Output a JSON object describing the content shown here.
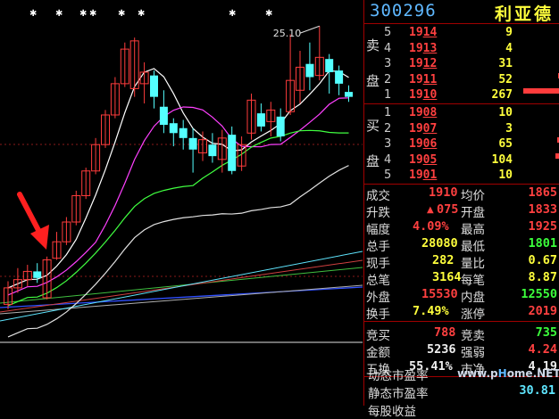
{
  "stock": {
    "code": "300296",
    "name": "利亚德"
  },
  "chart": {
    "peak_label": "25.10",
    "candles": [
      {
        "o": 8.2,
        "c": 9.2,
        "h": 9.6,
        "l": 7.9
      },
      {
        "o": 9.2,
        "c": 9.7,
        "h": 10.4,
        "l": 8.9
      },
      {
        "o": 9.7,
        "c": 10.2,
        "h": 10.6,
        "l": 9.3
      },
      {
        "o": 10.2,
        "c": 9.8,
        "h": 10.7,
        "l": 9.5
      },
      {
        "o": 8.6,
        "c": 10.9,
        "h": 11.1,
        "l": 8.5
      },
      {
        "o": 11.0,
        "c": 12.0,
        "h": 12.6,
        "l": 10.9
      },
      {
        "o": 12.0,
        "c": 13.2,
        "h": 13.5,
        "l": 11.8
      },
      {
        "o": 13.2,
        "c": 14.8,
        "h": 15.1,
        "l": 13.0
      },
      {
        "o": 14.8,
        "c": 16.3,
        "h": 16.5,
        "l": 14.6
      },
      {
        "o": 16.3,
        "c": 17.9,
        "h": 18.3,
        "l": 16.1
      },
      {
        "o": 17.9,
        "c": 19.7,
        "h": 20.0,
        "l": 17.7
      },
      {
        "o": 19.7,
        "c": 21.6,
        "h": 22.0,
        "l": 19.5
      },
      {
        "o": 21.6,
        "c": 23.7,
        "h": 24.1,
        "l": 21.4
      },
      {
        "o": 21.3,
        "c": 24.2,
        "h": 24.4,
        "l": 20.8
      },
      {
        "o": 21.6,
        "c": 22.3,
        "h": 22.9,
        "l": 20.4
      },
      {
        "o": 22.1,
        "c": 20.8,
        "h": 22.4,
        "l": 20.1
      },
      {
        "o": 20.2,
        "c": 19.1,
        "h": 21.2,
        "l": 18.6
      },
      {
        "o": 19.2,
        "c": 18.6,
        "h": 19.5,
        "l": 17.8
      },
      {
        "o": 18.9,
        "c": 18.3,
        "h": 19.4,
        "l": 17.6
      },
      {
        "o": 18.3,
        "c": 17.6,
        "h": 18.9,
        "l": 16.2
      },
      {
        "o": 17.4,
        "c": 18.2,
        "h": 18.7,
        "l": 16.9
      },
      {
        "o": 17.9,
        "c": 17.2,
        "h": 18.6,
        "l": 16.8
      },
      {
        "o": 17.0,
        "c": 18.3,
        "h": 18.8,
        "l": 16.2
      },
      {
        "o": 18.5,
        "c": 16.3,
        "h": 19.0,
        "l": 16.1
      },
      {
        "o": 16.6,
        "c": 17.9,
        "h": 18.4,
        "l": 16.3
      },
      {
        "o": 18.6,
        "c": 20.6,
        "h": 21.0,
        "l": 18.2
      },
      {
        "o": 19.8,
        "c": 19.0,
        "h": 20.4,
        "l": 18.7
      },
      {
        "o": 19.3,
        "c": 20.0,
        "h": 20.5,
        "l": 18.4
      },
      {
        "o": 19.6,
        "c": 18.4,
        "h": 20.1,
        "l": 18.1
      },
      {
        "o": 19.9,
        "c": 21.8,
        "h": 24.6,
        "l": 19.7
      },
      {
        "o": 21.2,
        "c": 22.6,
        "h": 23.6,
        "l": 20.4
      },
      {
        "o": 22.8,
        "c": 22.0,
        "h": 24.1,
        "l": 21.2
      },
      {
        "o": 22.1,
        "c": 23.2,
        "h": 25.1,
        "l": 21.8
      },
      {
        "o": 23.1,
        "c": 22.3,
        "h": 23.4,
        "l": 21.0
      },
      {
        "o": 22.4,
        "c": 21.6,
        "h": 22.7,
        "l": 20.9
      },
      {
        "o": 21.1,
        "c": 20.8,
        "h": 21.5,
        "l": 20.5
      }
    ]
  },
  "orderbook": {
    "sell_label": [
      "卖",
      "盘"
    ],
    "buy_label": [
      "买",
      "盘"
    ],
    "asks": [
      {
        "level": "5",
        "price": "1914",
        "vol": "9",
        "bar": 0
      },
      {
        "level": "4",
        "price": "1913",
        "vol": "4",
        "bar": 0
      },
      {
        "level": "3",
        "price": "1912",
        "vol": "31",
        "bar": 0
      },
      {
        "level": "2",
        "price": "1911",
        "vol": "52",
        "bar": 0.02
      },
      {
        "level": "1",
        "price": "1910",
        "vol": "267",
        "bar": 0.9
      }
    ],
    "bids": [
      {
        "level": "1",
        "price": "1908",
        "vol": "10",
        "bar": 0
      },
      {
        "level": "2",
        "price": "1907",
        "vol": "3",
        "bar": 0
      },
      {
        "level": "3",
        "price": "1906",
        "vol": "65",
        "bar": 0.05
      },
      {
        "level": "4",
        "price": "1905",
        "vol": "104",
        "bar": 0.1
      },
      {
        "level": "5",
        "price": "1901",
        "vol": "10",
        "bar": 0
      }
    ]
  },
  "stats": {
    "chengjiao_l": "成交",
    "chengjiao": "1910",
    "junjia_l": "均价",
    "junjia": "1865",
    "shengdie_l": "升跌",
    "shengdie": "075",
    "kaipan_l": "开盘",
    "kaipan": "1833",
    "fudu_l": "幅度",
    "fudu": "4.09%",
    "zuigao_l": "最高",
    "zuigao": "1925",
    "zongshou_l": "总手",
    "zongshou": "28080",
    "zuidi_l": "最低",
    "zuidi": "1801",
    "xianshou_l": "现手",
    "xianshou": "282",
    "liangbi_l": "量比",
    "liangbi": "0.67",
    "zongbi_l": "总笔",
    "zongbi": "3164",
    "meibi_l": "每笔",
    "meibi": "8.87",
    "waipan_l": "外盘",
    "waipan": "15530",
    "neipan_l": "内盘",
    "neipan": "12550",
    "huanshou_l": "换手",
    "huanshou": "7.49%",
    "zhangting_l": "涨停",
    "zhangting": "2019",
    "jingmai_l": "竞买",
    "jingmai": "788",
    "jingmai2_l": "竞卖",
    "jingmai2": "735",
    "jine_l": "金额",
    "jine": "5236",
    "qiangruo_l": "强弱",
    "qiangruo": "4.24",
    "wuhuan_l": "五换",
    "wuhuan": "55.41%",
    "shijing_l": "市净",
    "shijing": "4.19",
    "dongtai_l": "动态市盈率",
    "jingtai_l": "静态市盈率",
    "jingtai": "30.81",
    "tail_l": "每股收益"
  },
  "watermark": {
    "pre": "www.p",
    "mid": "H",
    "post": "ome.NET"
  },
  "colors": {
    "up": "#ff3c3c",
    "down": "#54ffff",
    "ask": "#ff4040",
    "label": "#dddddd"
  }
}
